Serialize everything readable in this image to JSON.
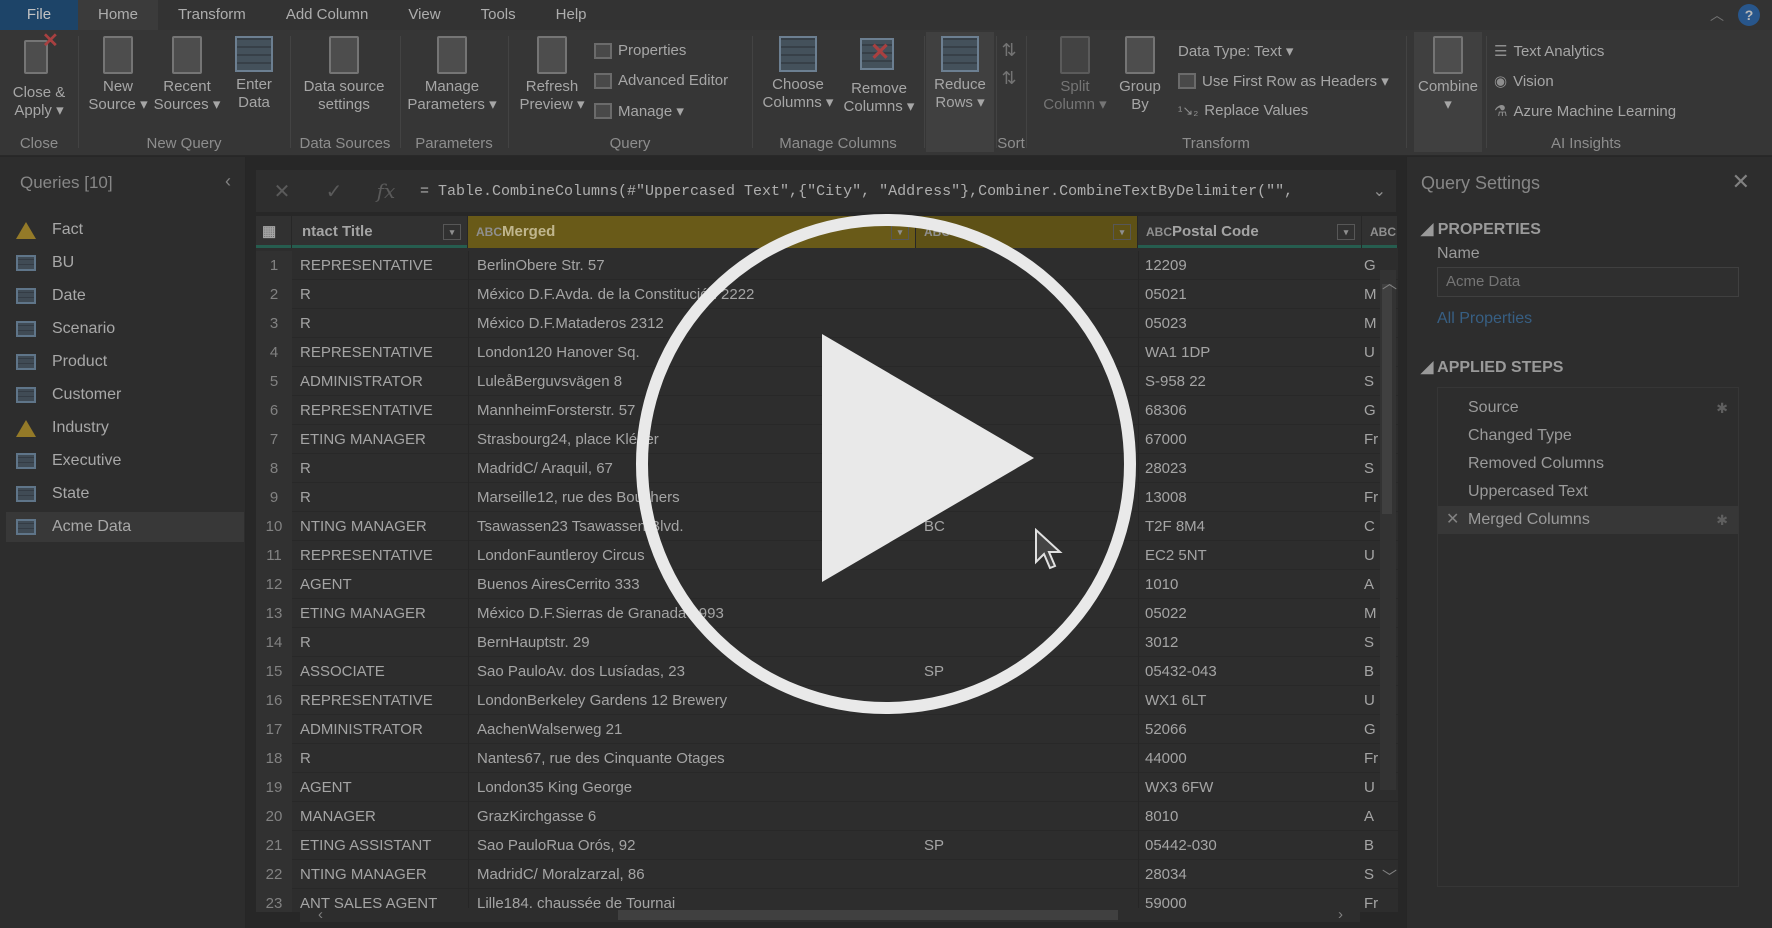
{
  "menu": {
    "file": "File",
    "tabs": [
      "Home",
      "Transform",
      "Add Column",
      "View",
      "Tools",
      "Help"
    ]
  },
  "ribbon": {
    "close_apply": [
      "Close &",
      "Apply ▾"
    ],
    "new_source": [
      "New",
      "Source ▾"
    ],
    "recent_sources": [
      "Recent",
      "Sources ▾"
    ],
    "enter_data": [
      "Enter",
      "Data"
    ],
    "data_source_settings": [
      "Data source",
      "settings"
    ],
    "manage_parameters": [
      "Manage",
      "Parameters ▾"
    ],
    "refresh_preview": [
      "Refresh",
      "Preview ▾"
    ],
    "properties": "Properties",
    "advanced_editor": "Advanced Editor",
    "manage": "Manage ▾",
    "choose_columns": [
      "Choose",
      "Columns ▾"
    ],
    "remove_columns": [
      "Remove",
      "Columns ▾"
    ],
    "reduce_rows": [
      "Reduce",
      "Rows ▾"
    ],
    "split_column": [
      "Split",
      "Column ▾"
    ],
    "group_by": [
      "Group",
      "By"
    ],
    "data_type": "Data Type: Text ▾",
    "use_first_row": "Use First Row as Headers ▾",
    "replace_values": "Replace Values",
    "combine": "Combine",
    "text_analytics": "Text Analytics",
    "vision": "Vision",
    "azure_ml": "Azure Machine Learning",
    "groups": {
      "close": "Close",
      "new_query": "New Query",
      "data_sources": "Data Sources",
      "parameters": "Parameters",
      "query": "Query",
      "manage_columns": "Manage Columns",
      "sort": "Sort",
      "transform": "Transform",
      "ai_insights": "AI Insights"
    }
  },
  "queries": {
    "title": "Queries [10]",
    "items": [
      {
        "label": "Fact",
        "icon": "warning-icon"
      },
      {
        "label": "BU",
        "icon": "table-icon"
      },
      {
        "label": "Date",
        "icon": "table-icon"
      },
      {
        "label": "Scenario",
        "icon": "table-icon"
      },
      {
        "label": "Product",
        "icon": "table-icon"
      },
      {
        "label": "Customer",
        "icon": "table-icon"
      },
      {
        "label": "Industry",
        "icon": "warning-icon"
      },
      {
        "label": "Executive",
        "icon": "table-icon"
      },
      {
        "label": "State",
        "icon": "table-icon"
      },
      {
        "label": "Acme Data",
        "icon": "table-icon"
      }
    ],
    "selected": "Acme Data"
  },
  "formula": "= Table.CombineColumns(#\"Uppercased Text\",{\"City\", \"Address\"},Combiner.CombineTextByDelimiter(\"\",",
  "grid": {
    "headers": [
      "ntact Title",
      "Merged",
      "",
      "Postal Code",
      ""
    ],
    "rows": [
      [
        "1",
        "REPRESENTATIVE",
        "BerlinObere Str. 57",
        "",
        "12209",
        "G"
      ],
      [
        "2",
        "R",
        "México D.F.Avda. de la Constitución 2222",
        "",
        "05021",
        "M"
      ],
      [
        "3",
        "R",
        "México D.F.Mataderos  2312",
        "",
        "05023",
        "M"
      ],
      [
        "4",
        "REPRESENTATIVE",
        "London120 Hanover Sq.",
        "",
        "WA1 1DP",
        "U"
      ],
      [
        "5",
        " ADMINISTRATOR",
        "LuleåBerguvsvägen  8",
        "",
        "S-958 22",
        "S"
      ],
      [
        "6",
        "REPRESENTATIVE",
        "MannheimForsterstr. 57",
        "",
        "68306",
        "G"
      ],
      [
        "7",
        "ETING MANAGER",
        "Strasbourg24, place Kléber",
        "",
        "67000",
        "Fr"
      ],
      [
        "8",
        "R",
        "MadridC/ Araquil, 67",
        "",
        "28023",
        "S"
      ],
      [
        "9",
        "R",
        "Marseille12, rue des Bouchers",
        "",
        "13008",
        "Fr"
      ],
      [
        "10",
        "NTING MANAGER",
        "Tsawassen23 Tsawassen Blvd.",
        "BC",
        "T2F 8M4",
        "C"
      ],
      [
        "11",
        "REPRESENTATIVE",
        "LondonFauntleroy Circus",
        "",
        "EC2 5NT",
        "U"
      ],
      [
        "12",
        "AGENT",
        "Buenos AiresCerrito 333",
        "",
        "1010",
        "A"
      ],
      [
        "13",
        "ETING MANAGER",
        "México D.F.Sierras de Granada 9993",
        "",
        "05022",
        "M"
      ],
      [
        "14",
        "R",
        "BernHauptstr. 29",
        "",
        "3012",
        "S"
      ],
      [
        "15",
        "ASSOCIATE",
        "Sao PauloAv. dos Lusíadas, 23",
        "SP",
        "05432-043",
        "B"
      ],
      [
        "16",
        "REPRESENTATIVE",
        "LondonBerkeley Gardens 12  Brewery",
        "",
        "WX1 6LT",
        "U"
      ],
      [
        "17",
        " ADMINISTRATOR",
        "AachenWalserweg 21",
        "",
        "52066",
        "G"
      ],
      [
        "18",
        "R",
        "Nantes67, rue des Cinquante Otages",
        "",
        "44000",
        "Fr"
      ],
      [
        "19",
        "AGENT",
        "London35 King George",
        "",
        "WX3 6FW",
        "U"
      ],
      [
        "20",
        "MANAGER",
        "GrazKirchgasse 6",
        "",
        "8010",
        "A"
      ],
      [
        "21",
        "ETING ASSISTANT",
        "Sao PauloRua Orós, 92",
        "SP",
        "05442-030",
        "B"
      ],
      [
        "22",
        "NTING MANAGER",
        "MadridC/ Moralzarzal, 86",
        "",
        "28034",
        "S"
      ],
      [
        "23",
        "ANT SALES AGENT",
        "Lille184, chaussée de Tournai",
        "",
        "59000",
        "Fr"
      ]
    ]
  },
  "settings": {
    "title": "Query Settings",
    "properties": "PROPERTIES",
    "name_label": "Name",
    "name_value": "Acme Data",
    "all_properties": "All Properties",
    "applied_steps": "APPLIED STEPS",
    "steps": [
      "Source",
      "Changed Type",
      "Removed Columns",
      "Uppercased Text",
      "Merged Columns"
    ],
    "selected_step": "Merged Columns"
  },
  "colors": {
    "accent": "#2c64a5",
    "merged_header": "#7c6a19",
    "play": "#e9e9e9"
  }
}
